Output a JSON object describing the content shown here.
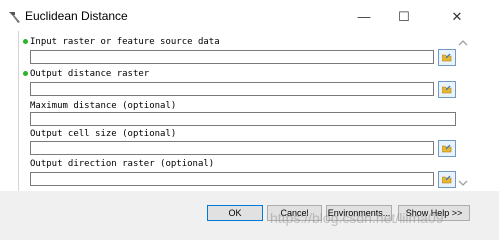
{
  "window": {
    "title": "Euclidean Distance",
    "minimize_glyph": "—",
    "maximize_glyph": "☐",
    "close_glyph": "✕"
  },
  "form": {
    "fields": [
      {
        "label": "Input raster or feature source data",
        "value": "",
        "required": true,
        "has_browse": true
      },
      {
        "label": "Output distance raster",
        "value": "",
        "required": true,
        "has_browse": true
      },
      {
        "label": "Maximum distance (optional)",
        "value": "",
        "required": false,
        "has_browse": false
      },
      {
        "label": "Output cell size (optional)",
        "value": "",
        "required": false,
        "has_browse": true
      },
      {
        "label": "Output direction raster (optional)",
        "value": "",
        "required": false,
        "has_browse": true
      }
    ]
  },
  "buttons": {
    "ok": "OK",
    "cancel": "Cancel",
    "environments": "Environments...",
    "show_help": "Show Help >>"
  },
  "watermark": "https://blog.csdn.net/lilma09",
  "colors": {
    "required_dot": "#2ab52a",
    "folder_icon": "#e8b830",
    "bottom_bar": "#f0f0f0"
  },
  "icons": {
    "app": "hammer-icon",
    "browse": "open-folder-icon"
  }
}
